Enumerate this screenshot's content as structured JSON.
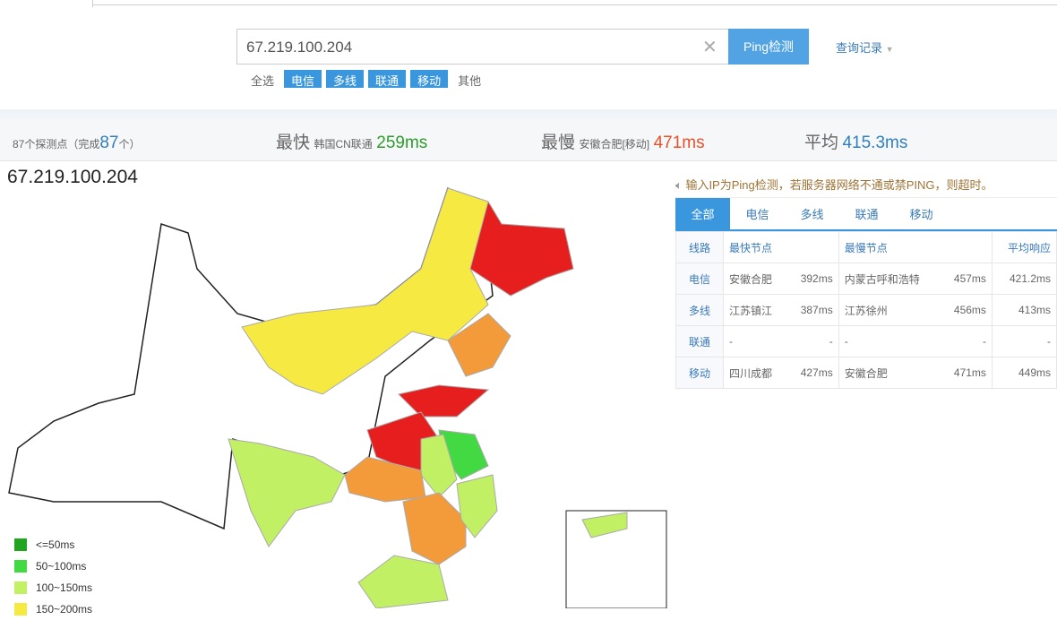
{
  "search": {
    "value": "67.219.100.204",
    "button": "Ping检测",
    "history": "查询记录"
  },
  "filters": {
    "all": "全选",
    "items": [
      "电信",
      "多线",
      "联通",
      "移动"
    ],
    "other": "其他"
  },
  "stats": {
    "nodes_prefix": "87个探测点（完成",
    "done": "87",
    "nodes_suffix": "个）",
    "fast_label": "最快",
    "fast_node": "韩国CN联通",
    "fast_value": "259ms",
    "slow_label": "最慢",
    "slow_node": "安徽合肥[移动]",
    "slow_value": "471ms",
    "avg_label": "平均",
    "avg_value": "415.3ms"
  },
  "ip_title": "67.219.100.204",
  "notice": "输入IP为Ping检测，若服务器网络不通或禁PING，则超时。",
  "tabs": [
    "全部",
    "电信",
    "多线",
    "联通",
    "移动"
  ],
  "table": {
    "headers": [
      "线路",
      "最快节点",
      "最慢节点",
      "平均响应"
    ],
    "rows": [
      {
        "line": "电信",
        "fast": "安徽合肥",
        "fast_ms": "392ms",
        "slow": "内蒙古呼和浩特",
        "slow_ms": "457ms",
        "avg": "421.2ms"
      },
      {
        "line": "多线",
        "fast": "江苏镇江",
        "fast_ms": "387ms",
        "slow": "江苏徐州",
        "slow_ms": "456ms",
        "avg": "413ms"
      },
      {
        "line": "联通",
        "fast": "-",
        "fast_ms": "-",
        "slow": "-",
        "slow_ms": "-",
        "avg": "-"
      },
      {
        "line": "移动",
        "fast": "四川成都",
        "fast_ms": "427ms",
        "slow": "安徽合肥",
        "slow_ms": "471ms",
        "avg": "449ms"
      }
    ]
  },
  "legend": [
    {
      "label": "<=50ms",
      "color": "#1fa51f"
    },
    {
      "label": "50~100ms",
      "color": "#42d942"
    },
    {
      "label": "100~150ms",
      "color": "#c1f064"
    },
    {
      "label": "150~200ms",
      "color": "#f5e942"
    }
  ]
}
